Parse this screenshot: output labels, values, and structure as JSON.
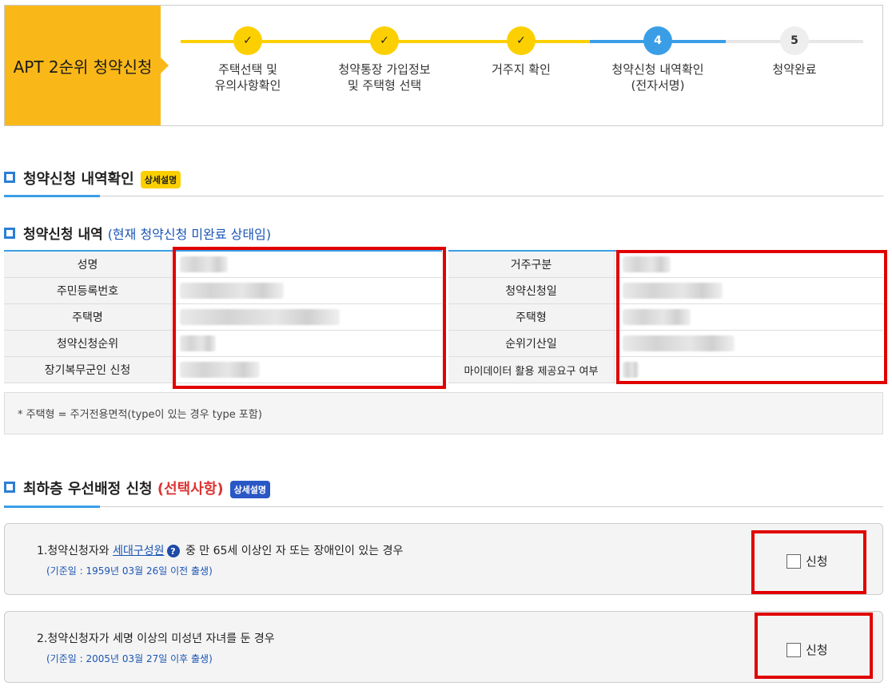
{
  "stepper": {
    "title": "APT 2순위 청약신청",
    "steps": [
      {
        "num": "✓",
        "label1": "주택선택 및",
        "label2": "유의사항확인",
        "state": "done"
      },
      {
        "num": "✓",
        "label1": "청약통장 가입정보",
        "label2": "및 주택형 선택",
        "state": "done"
      },
      {
        "num": "✓",
        "label1": "거주지 확인",
        "label2": "",
        "state": "done"
      },
      {
        "num": "4",
        "label1": "청약신청 내역확인",
        "label2": "(전자서명)",
        "state": "current"
      },
      {
        "num": "5",
        "label1": "청약완료",
        "label2": "",
        "state": "todo"
      }
    ]
  },
  "section1": {
    "title": "청약신청 내역확인",
    "badge": "상세설명"
  },
  "detail": {
    "title": "청약신청 내역",
    "note": "(현재 청약신청 미완료 상태임)",
    "left_labels": [
      "성명",
      "주민등록번호",
      "주택명",
      "청약신청순위",
      "장기복무군인 신청"
    ],
    "right_labels": [
      "거주구분",
      "청약신청일",
      "주택형",
      "순위기산일",
      "마이데이터 활용 제공요구 여부"
    ],
    "footnote": "* 주택형 = 주거전용면적(type이 있는 경우 type 포함)"
  },
  "section2": {
    "title": "최하층 우선배정 신청",
    "title_note": "(선택사항)",
    "badge": "상세설명"
  },
  "items": [
    {
      "prefix": "1.청약신청자와 ",
      "link": "세대구성원",
      "help": "?",
      "suffix": " 중 만 65세 이상인 자 또는 장애인이 있는 경우",
      "sub": "(기준일 : 1959년 03월 26일 이전 출생)",
      "check_label": "신청"
    },
    {
      "prefix": "2.청약신청자가 세명 이상의 미성년 자녀를 둔 경우",
      "link": "",
      "help": "",
      "suffix": "",
      "sub": "(기준일 : 2005년 03월 27일 이후 출생)",
      "check_label": "신청"
    }
  ],
  "colors": {
    "accent_yellow": "#fab818",
    "step_done": "#fcd000",
    "step_current": "#3a9ee6",
    "highlight_red": "#e00000"
  }
}
